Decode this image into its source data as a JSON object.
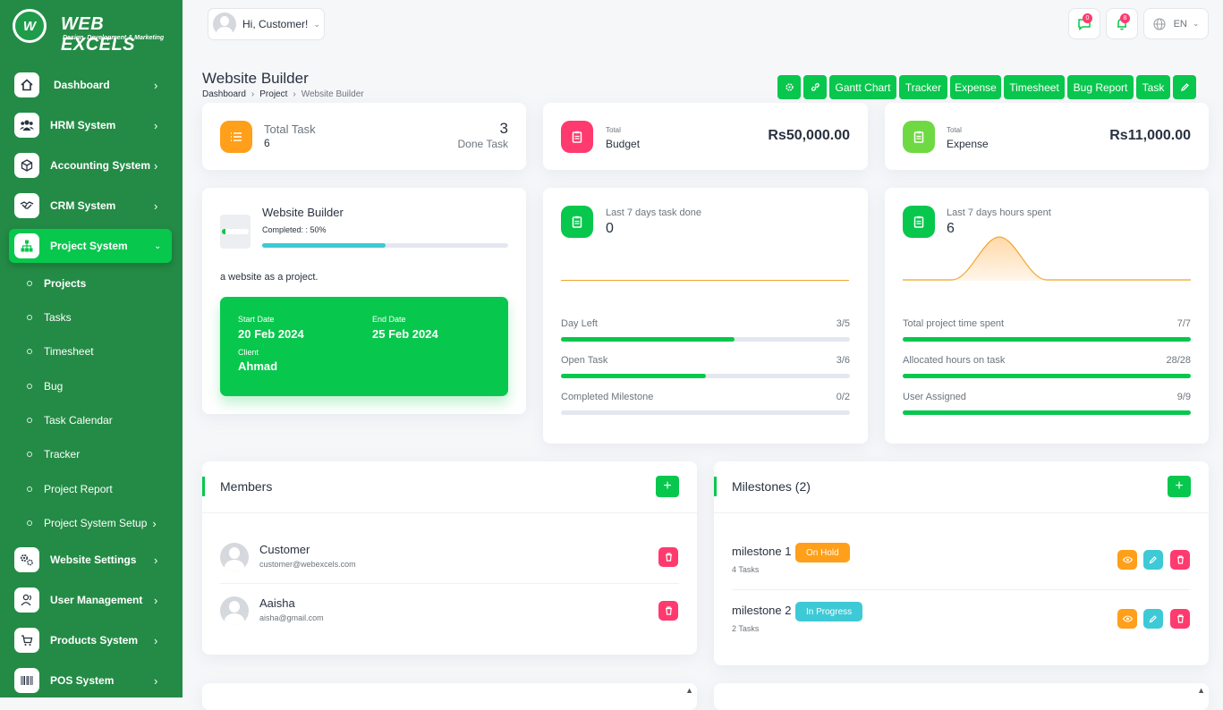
{
  "brand": {
    "name": "WEB EXCELS",
    "tagline": "Design, Development & Marketing",
    "mark": "W"
  },
  "sidebar": {
    "items": [
      {
        "label": "Dashboard",
        "icon": "home-icon"
      },
      {
        "label": "HRM System",
        "icon": "users-icon"
      },
      {
        "label": "Accounting System",
        "icon": "box-icon"
      },
      {
        "label": "CRM System",
        "icon": "handshake-icon"
      },
      {
        "label": "Project System",
        "icon": "sitemap-icon"
      }
    ],
    "project_sub": [
      "Projects",
      "Tasks",
      "Timesheet",
      "Bug",
      "Task Calendar",
      "Tracker",
      "Project Report",
      "Project System Setup"
    ],
    "lower_items": [
      {
        "label": "Website Settings",
        "icon": "cogs-icon"
      },
      {
        "label": "User Management",
        "icon": "user-icon"
      },
      {
        "label": "Products System",
        "icon": "cart-icon"
      },
      {
        "label": "POS System",
        "icon": "barcode-icon"
      }
    ]
  },
  "topbar": {
    "greeting": "Hi, Customer!",
    "messages_count": "0",
    "notifications_count": "8",
    "language": "EN"
  },
  "page": {
    "title": "Website Builder",
    "breadcrumb": [
      "Dashboard",
      "Project",
      "Website Builder"
    ],
    "actions": [
      "Gantt Chart",
      "Tracker",
      "Expense",
      "Timesheet",
      "Bug Report",
      "Task"
    ]
  },
  "stats": {
    "total_task_label": "Total Task",
    "total_task_value": "6",
    "done_task_value": "3",
    "done_task_label": "Done Task",
    "budget_small": "Total",
    "budget_label": "Budget",
    "budget_value": "Rs50,000.00",
    "expense_small": "Total",
    "expense_label": "Expense",
    "expense_value": "Rs11,000.00"
  },
  "project": {
    "name": "Website Builder",
    "completed_text": "Completed: : 50%",
    "completed_pct": 0.5,
    "description": "a website as a project.",
    "start_label": "Start Date",
    "start_value": "20 Feb 2024",
    "end_label": "End Date",
    "end_value": "25 Feb 2024",
    "client_label": "Client",
    "client_value": "Ahmad"
  },
  "task_panel": {
    "label": "Last 7 days task done",
    "value": "0",
    "rows": [
      {
        "label": "Day Left",
        "value": "3/5",
        "fraction": 0.6
      },
      {
        "label": "Open Task",
        "value": "3/6",
        "fraction": 0.5
      },
      {
        "label": "Completed Milestone",
        "value": "0/2",
        "fraction": 0
      }
    ]
  },
  "hours_panel": {
    "label": "Last 7 days hours spent",
    "value": "6",
    "rows": [
      {
        "label": "Total project time spent",
        "value": "7/7",
        "fraction": 1
      },
      {
        "label": "Allocated hours on task",
        "value": "28/28",
        "fraction": 1
      },
      {
        "label": "User Assigned",
        "value": "9/9",
        "fraction": 1
      }
    ]
  },
  "members": {
    "title": "Members",
    "list": [
      {
        "name": "Customer",
        "email": "customer@webexcels.com"
      },
      {
        "name": "Aaisha",
        "email": "aisha@gmail.com"
      }
    ]
  },
  "milestones": {
    "title": "Milestones (2)",
    "list": [
      {
        "name": "milestone 1",
        "status": "On Hold",
        "status_color": "#ff9f1a",
        "tasks": "4 Tasks"
      },
      {
        "name": "milestone 2",
        "status": "In Progress",
        "status_color": "#3ec9d6",
        "tasks": "2 Tasks"
      }
    ]
  },
  "colors": {
    "sidebar": "#238b45",
    "accent": "#08c74d",
    "danger": "#ff3a6e",
    "warning": "#ff9f1a",
    "info": "#3ec9d6"
  }
}
